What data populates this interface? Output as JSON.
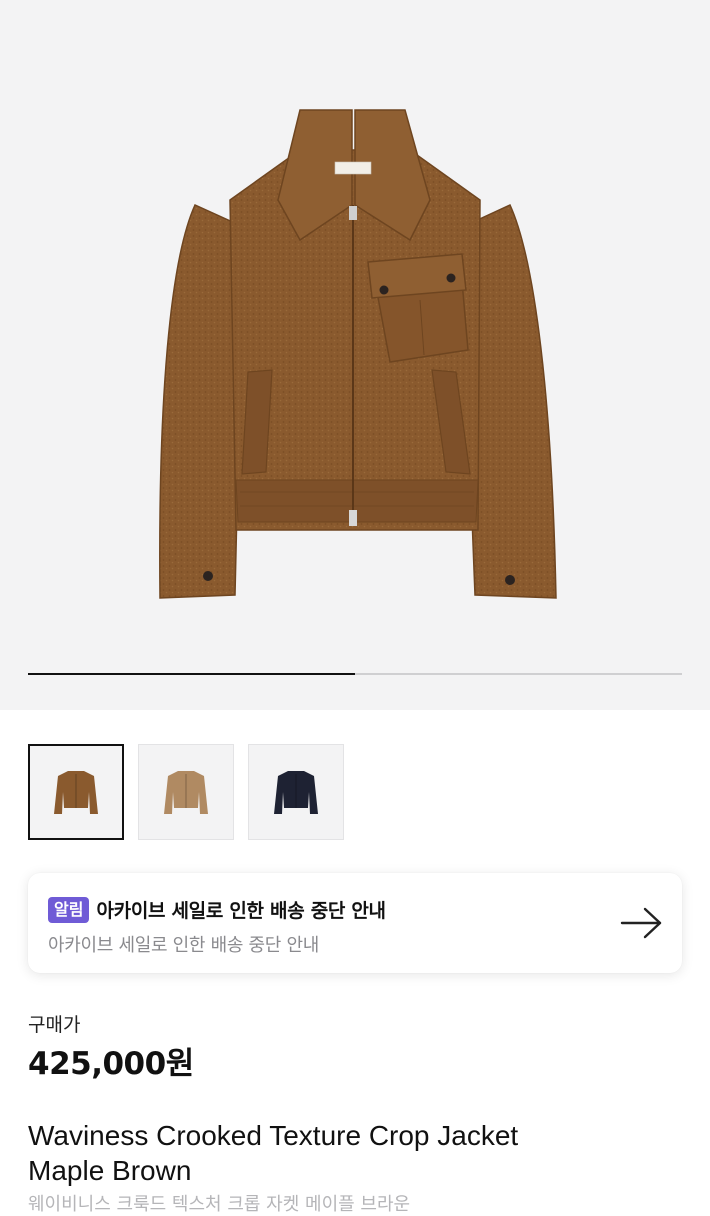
{
  "gallery": {
    "current_slide": 1,
    "total_slides": 2,
    "progress_fraction": 0.5,
    "jacket_color": "#8a5a2e",
    "thumbnails": [
      {
        "name": "thumbnail-maple-brown",
        "color": "#8a5a2e",
        "selected": true
      },
      {
        "name": "thumbnail-beige",
        "color": "#b08a62",
        "selected": false
      },
      {
        "name": "thumbnail-navy",
        "color": "#1e2233",
        "selected": false
      }
    ]
  },
  "notice": {
    "badge": "알림",
    "title": "아카이브 세일로 인한 배송 중단 안내",
    "subtitle": "아카이브 세일로 인한 배송 중단 안내",
    "arrow_icon": "arrow-right-icon",
    "badge_color": "#6f5bd6"
  },
  "price": {
    "label": "구매가",
    "value": "425,000원"
  },
  "product": {
    "name_line1": "Waviness Crooked Texture Crop Jacket",
    "name_line2": "Maple Brown",
    "name_kr": "웨이비니스 크룩드 텍스처 크롭 자켓 메이플 브라운"
  }
}
